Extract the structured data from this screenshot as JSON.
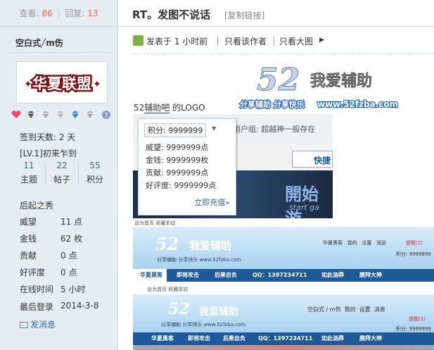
{
  "stats": {
    "views_label": "查看:",
    "views": "86",
    "replies_label": "回复:",
    "replies": "13"
  },
  "user": {
    "name": "空白式╱m伤",
    "avatar_text": "华夏联盟",
    "signin_days": "签到天数: 2 天",
    "level": "[LV.1]初来乍到",
    "counts": [
      {
        "num": "11",
        "label": "主题"
      },
      {
        "num": "22",
        "label": "帖子"
      },
      {
        "num": "55",
        "label": "积分"
      }
    ],
    "rank": "后起之秀",
    "attrs": [
      {
        "label": "威望",
        "value": "11 点"
      },
      {
        "label": "金钱",
        "value": "62 枚"
      },
      {
        "label": "贡献",
        "value": "0 点"
      },
      {
        "label": "好评度",
        "value": "0 点"
      },
      {
        "label": "在线时间",
        "value": "5 小时"
      },
      {
        "label": "最后登录",
        "value": "2014-3-8"
      }
    ],
    "send_msg": "发消息"
  },
  "post": {
    "title": "RT。发图不说话",
    "copy_link": "[复制链接]",
    "posted": "发表于 1 小时前",
    "only_author": "只看该作者",
    "big_image": "只看大图",
    "text_a": "52",
    "text_link": "辅助吧",
    "text_b": " 的LOGO",
    "logo": {
      "num": "52",
      "name": "我爱辅助",
      "slogan": "分享辅助  分享快乐",
      "url": "www.52fzba.com"
    }
  },
  "shot1": {
    "score_label": "积分: 9999999",
    "group_label": "用户组: 超越神一般存在",
    "popup": [
      "威望: 9999999点",
      "金钱: 9999999枚",
      "贡献: 9999999点",
      "好评度: 9999999点"
    ],
    "recharge": "立即充值»",
    "quick_btn": "快捷",
    "banner": "開始游",
    "banner_sub": "start ga"
  },
  "shot2": {
    "top_links": "设为首页  收藏本站",
    "num": "52",
    "name": "我爱辅助",
    "slogan": "分享辅助  分享快乐  www.52fzba.com",
    "userbar": [
      "华夏黑客",
      "我的",
      "设置",
      "消息"
    ],
    "reminder": "提醒(1)",
    "score": "积分: 9999999",
    "nav": [
      "华夏黑客",
      "即将攻击",
      "后果自负",
      "QQ：1397234711",
      "如此汹莽",
      "膜拜大神"
    ]
  },
  "shot3": {
    "top_links": "设为首页  收藏本站",
    "num": "52",
    "name": "我爱辅助",
    "slogan": "分享辅助  分享快乐  www.52fzba.com",
    "user": "空白式 / m伤",
    "userbar": [
      "我的",
      "设置",
      "消息"
    ],
    "reminder": "提醒(1)",
    "score": "积分: 9999999",
    "nav": [
      "华夏黑客",
      "即将攻击",
      "后果自负",
      "QQ：1397234711",
      "如此汹莽",
      "膜拜大神"
    ]
  },
  "colors": {
    "sidebar_bg": "#e5edf2",
    "accent": "#f26c4f",
    "link": "#336699",
    "nav_blue": "#1e5a9a"
  }
}
